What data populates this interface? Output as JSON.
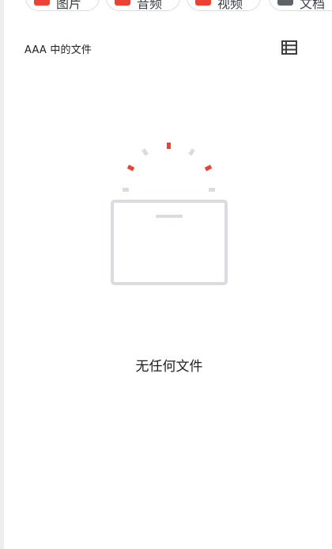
{
  "filter_chips": [
    {
      "label": "图片",
      "icon": "image-icon",
      "color": "#ea4335"
    },
    {
      "label": "音频",
      "icon": "audio-icon",
      "color": "#ea4335"
    },
    {
      "label": "视频",
      "icon": "video-icon",
      "color": "#ea4335"
    },
    {
      "label": "文档",
      "icon": "document-icon",
      "color": "#5f6368"
    }
  ],
  "section": {
    "title": "AAA 中的文件",
    "view_toggle_icon": "list-view-icon"
  },
  "empty_state": {
    "message": "无任何文件",
    "illustration_icon": "empty-folder-icon"
  },
  "colors": {
    "accent_red": "#ea4335",
    "illustration_gray": "#dadce0",
    "text": "#202124"
  }
}
